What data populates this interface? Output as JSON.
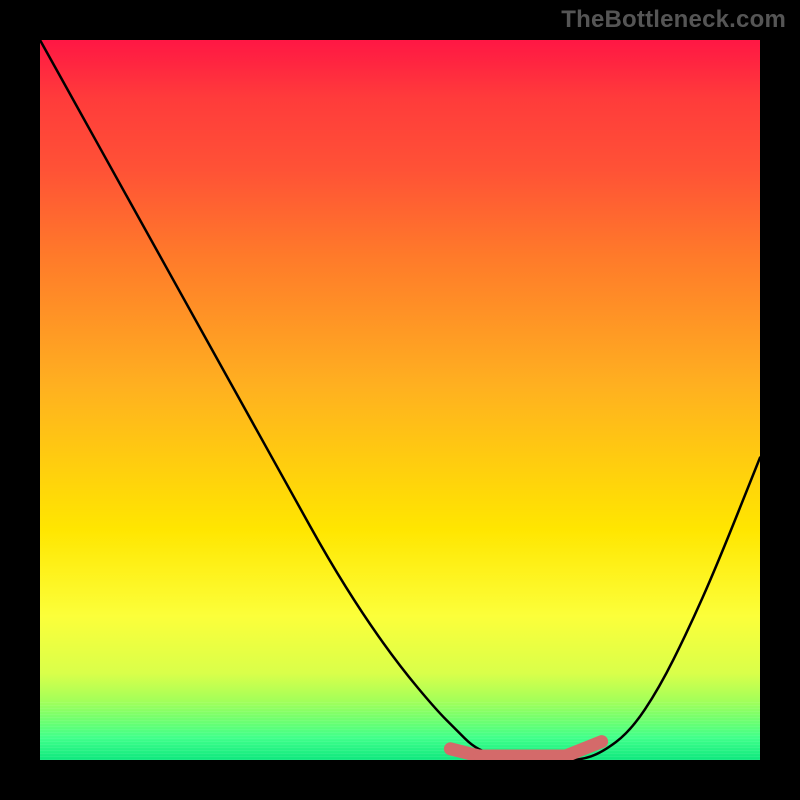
{
  "watermark": "TheBottleneck.com",
  "chart_data": {
    "type": "line",
    "title": "",
    "xlabel": "",
    "ylabel": "",
    "xlim": [
      0,
      100
    ],
    "ylim": [
      0,
      100
    ],
    "series": [
      {
        "name": "bottleneck-curve",
        "x": [
          0,
          5,
          10,
          15,
          20,
          25,
          30,
          35,
          40,
          45,
          50,
          55,
          58,
          60,
          62,
          65,
          68,
          70,
          72,
          75,
          78,
          82,
          86,
          90,
          94,
          100
        ],
        "y": [
          100,
          91,
          82,
          73,
          64,
          55,
          46,
          37,
          28,
          20,
          13,
          7,
          4,
          2,
          1,
          0,
          0,
          0,
          0,
          0,
          1,
          4,
          10,
          18,
          27,
          42
        ]
      }
    ],
    "markers": [
      {
        "name": "optimal-band-left",
        "x": 57,
        "y": 1,
        "color": "#d46a6a",
        "r": 6
      },
      {
        "name": "optimal-band-mid1",
        "x": 61,
        "y": 0,
        "color": "#d46a6a",
        "r": 6
      },
      {
        "name": "optimal-band-mid2",
        "x": 65,
        "y": 0,
        "color": "#d46a6a",
        "r": 6
      },
      {
        "name": "optimal-band-mid3",
        "x": 69,
        "y": 0,
        "color": "#d46a6a",
        "r": 6
      },
      {
        "name": "optimal-band-mid4",
        "x": 73,
        "y": 0,
        "color": "#d46a6a",
        "r": 6
      },
      {
        "name": "optimal-band-right",
        "x": 78,
        "y": 2,
        "color": "#d46a6a",
        "r": 6
      }
    ],
    "background_gradient": {
      "top": "#ff1744",
      "mid": "#ffe600",
      "bottom": "#00e676"
    }
  }
}
